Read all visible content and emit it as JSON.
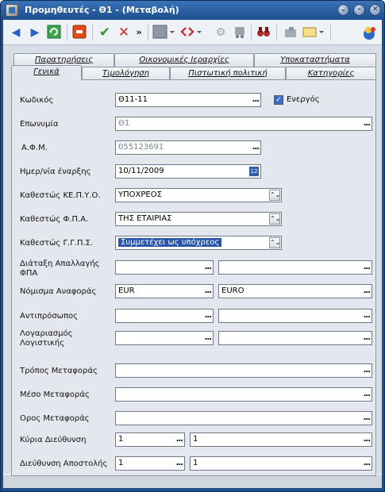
{
  "window": {
    "title": "Προμηθευτές - Θ1 - (Μεταβολή)"
  },
  "title_buttons": [
    "⌄",
    "–",
    "✕"
  ],
  "toolbar": {
    "expand": "»",
    "expand2": "»"
  },
  "tabs_back": [
    "Παρατηρήσεις",
    "Οικονομικές Ιεραρχίες",
    "Υποκαταστήματα"
  ],
  "tabs_front": [
    "Γενικά",
    "Τιμολόγηση",
    "Πιστωτική πολιτική",
    "Κατηγορίες"
  ],
  "form": {
    "code": {
      "label": "Κωδικός",
      "value": "Θ11-11"
    },
    "active": {
      "label": "Ενεργός",
      "checked": true
    },
    "name": {
      "label": "Επωνυμία",
      "value": "Θ1"
    },
    "afm": {
      "label": "Α.Φ.Μ.",
      "value": "055123691"
    },
    "start_date": {
      "label": "Ημερ/νία έναρξης",
      "value": "10/11/2009"
    },
    "kepyo": {
      "label": "Καθεστώς ΚΕ.Π.Υ.Ο.",
      "value": "ΥΠΟΧΡΕΟΣ"
    },
    "fpa": {
      "label": "Καθεστώς Φ.Π.Α.",
      "value": "ΤΗΣ ΕΤΑΙΡΙΑΣ"
    },
    "ggps": {
      "label": "Καθεστώς  Γ.Γ.Π.Σ.",
      "value": "Συμμετέχει ως υπόχρεος"
    },
    "vat_exempt": {
      "label": "Διάταξη Απαλλαγής ΦΠΑ",
      "value1": "",
      "value2": ""
    },
    "currency": {
      "label": "Νόμισμα Αναφοράς",
      "value1": "EUR",
      "value2": "EURO"
    },
    "representative": {
      "label": "Αντιπρόσωπος",
      "value1": "",
      "value2": ""
    },
    "accounting": {
      "label": "Λογαριασμός Λογιστικής",
      "value1": "",
      "value2": ""
    },
    "transport_method": {
      "label": "Τρόπος Μεταφοράς",
      "value": ""
    },
    "transport_means": {
      "label": "Μέσο Μεταφοράς",
      "value": ""
    },
    "transport_term": {
      "label": "Ορος Μεταφοράς",
      "value": ""
    },
    "main_address": {
      "label": "Κύρια Διεύθυνση",
      "value1": "1",
      "value2": "1"
    },
    "shipping_address": {
      "label": "Διεύθυνση Αποστολής",
      "value1": "1",
      "value2": "1"
    }
  },
  "ellipsis": "...",
  "date_icon": "12"
}
